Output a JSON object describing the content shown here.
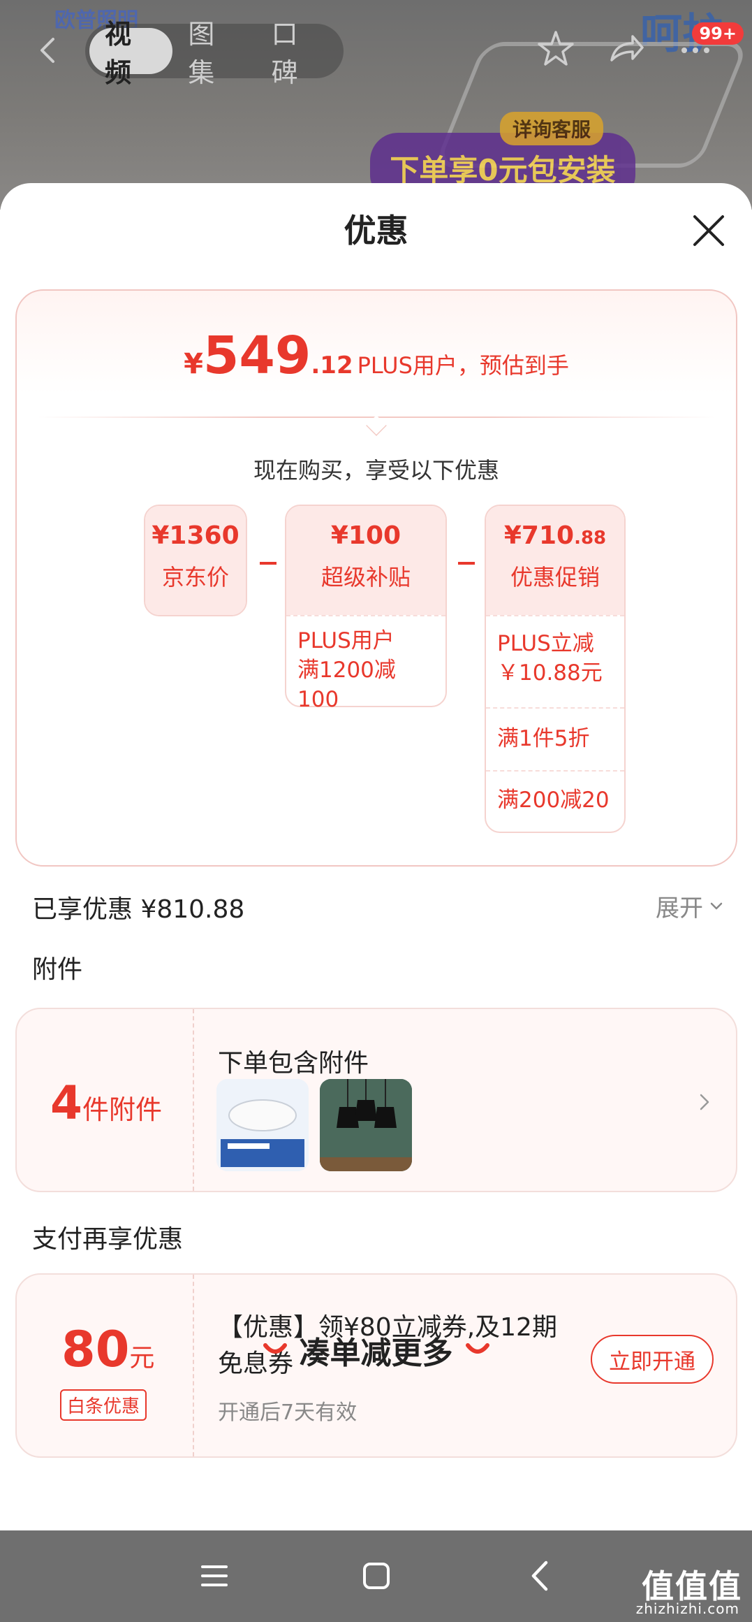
{
  "header": {
    "brand": "欧普照明",
    "tabs": [
      {
        "label": "视频",
        "active": true
      },
      {
        "label": "图集",
        "active": false
      },
      {
        "label": "口碑",
        "active": false
      }
    ],
    "cart_badge": "99+",
    "promo_tag": "详询客服",
    "promo_text": "下单享0元包安装",
    "promo_top": "呵护"
  },
  "sheet": {
    "title": "优惠",
    "summary": {
      "currency": "¥",
      "price_int": "549",
      "price_dec": ".12",
      "price_note": "PLUS用户，预估到手",
      "buy_now": "现在购买，享受以下优惠",
      "boxes": [
        {
          "amount": "¥1360",
          "label": "京东价",
          "rows": []
        },
        {
          "amount": "¥100",
          "label": "超级补贴",
          "rows": [
            "PLUS用户\n满1200减100"
          ]
        },
        {
          "amount_int": "¥710",
          "amount_dec": ".88",
          "label": "优惠促销",
          "rows": [
            "PLUS立减\n￥10.88元",
            "满1件5折",
            "满200减20"
          ]
        }
      ]
    },
    "enjoyed": "已享优惠 ¥810.88",
    "expand": "展开",
    "attachments": {
      "heading": "附件",
      "count": "4",
      "count_unit": "件附件",
      "title": "下单包含附件",
      "thumbs": [
        "ceiling-lamp-thumb",
        "pendant-lamp-thumb"
      ]
    },
    "payment": {
      "heading": "支付再享优惠",
      "amount": "80",
      "unit": "元",
      "tag": "白条优惠",
      "desc": "【优惠】领¥80立减券,及12期免息券",
      "valid": "开通后7天有效",
      "button": "立即开通"
    },
    "more": "凑单减更多"
  },
  "watermark": {
    "main": "值值值",
    "sub": "zhizhizhi.com"
  },
  "colors": {
    "accent": "#e8382c",
    "card_bg": "#fff7f6",
    "navbar": "#6f6f6f"
  }
}
